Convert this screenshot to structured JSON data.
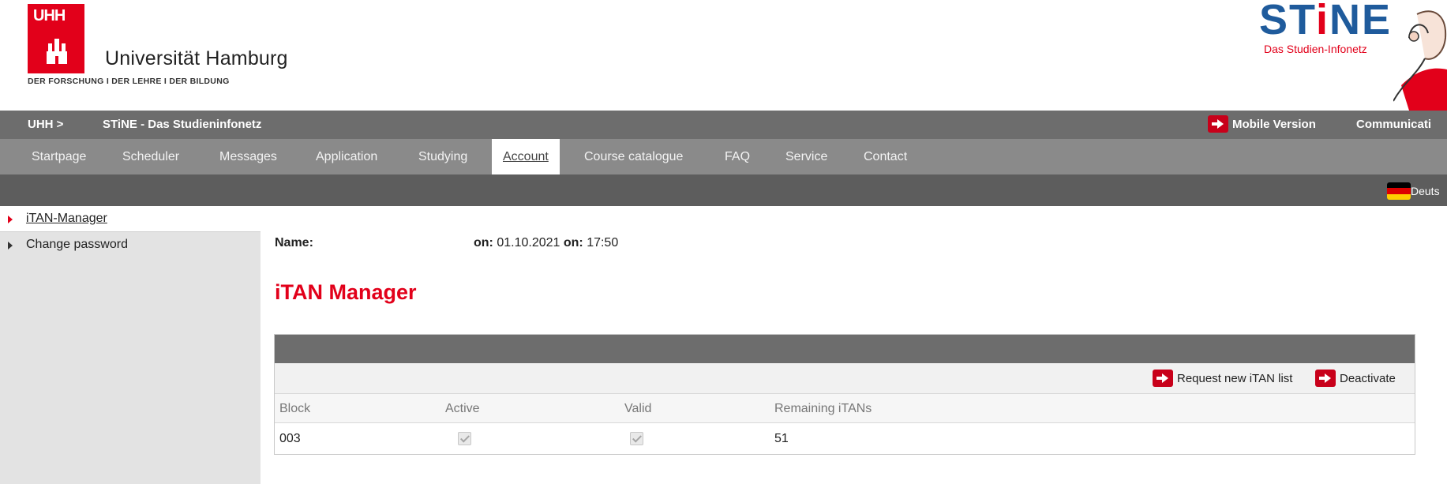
{
  "header": {
    "uhh_mark": "UHH",
    "university_name": "Universität Hamburg",
    "tagline": "DER FORSCHUNG I DER LEHRE I DER BILDUNG",
    "stine_title": "STiNE",
    "stine_subtitle": "Das Studien-Infonetz"
  },
  "topbar": {
    "breadcrumb_uhh": "UHH >",
    "breadcrumb_stine": "STiNE - Das Studieninfonetz",
    "mobile_label": "Mobile Version",
    "communication_label": "Communicati"
  },
  "nav": {
    "items": [
      "Startpage",
      "Scheduler",
      "Messages",
      "Application",
      "Studying",
      "Account",
      "Course catalogue",
      "FAQ",
      "Service",
      "Contact"
    ],
    "active": "Account"
  },
  "language": {
    "label": "Deuts",
    "flag_colors": [
      "#000000",
      "#dd0000",
      "#ffce00"
    ]
  },
  "sidebar": {
    "items": [
      {
        "label": "iTAN-Manager",
        "active": true
      },
      {
        "label": "Change password",
        "active": false
      }
    ]
  },
  "main": {
    "name_label": "Name:",
    "on_label_1": "on:",
    "date": "01.10.2021",
    "on_label_2": "on:",
    "time": "17:50",
    "title": "iTAN Manager"
  },
  "itan_table": {
    "actions": {
      "request_label": "Request new iTAN list",
      "deactivate_label": "Deactivate"
    },
    "columns": [
      "Block",
      "Active",
      "Valid",
      "Remaining iTANs"
    ],
    "rows": [
      {
        "block": "003",
        "active": true,
        "valid": true,
        "remaining": "51"
      }
    ]
  },
  "colors": {
    "accent_red": "#e2001a",
    "stine_blue": "#1f5b9c",
    "bar_dark": "#6d6d6d",
    "bar_mid": "#8a8a8a"
  }
}
